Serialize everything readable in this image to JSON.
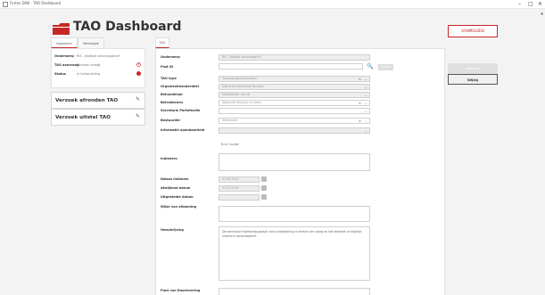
{
  "window": {
    "title": "Fortes DAB - TAO Dashboard",
    "minimize_glyph": "–",
    "maximize_glyph": "□",
    "close_glyph": "✕"
  },
  "header": {
    "page_title": "TAO Dashboard",
    "action_button_label": "AANMELDEN"
  },
  "left_panel": {
    "tabs": [
      {
        "label": "Algemeen"
      },
      {
        "label": "Werkwijze"
      }
    ],
    "info_rows": [
      {
        "key": "Onderwerp",
        "value": "RIS - digitale aanvraagbrief",
        "indicator": "none"
      },
      {
        "key": "TAO aanvraag",
        "value": "Thomas vraagt",
        "indicator": "alarm"
      },
      {
        "key": "Status",
        "value": "In behandeling",
        "indicator": "red"
      }
    ],
    "action_cards": [
      {
        "label": "Verzoek afronden TAO"
      },
      {
        "label": "Verzoek uitstel TAO"
      }
    ],
    "edit_glyph": "✎"
  },
  "form": {
    "tab_label": "TAO",
    "search_button_label": "Zoeken",
    "search_glyph": "🔍",
    "chevron_glyph": "⌄",
    "clear_glyph": "⊗",
    "fields": [
      {
        "label": "Onderwerp",
        "value": "RIS - digitale aanvraagbrief"
      },
      {
        "label": "Post ID",
        "value": ""
      },
      {
        "label": "TAO type",
        "value": "Toezeggingen/afspraken"
      },
      {
        "label": "Organisatieonderdeel",
        "value": "Dienst Infrastructuur Burgers"
      },
      {
        "label": "Behandelaar",
        "value": "Medewerker van de"
      },
      {
        "label": "Betrokkenen",
        "value": "Algemeen Bestuur en leden"
      },
      {
        "label": "Secretaris Portefeuille",
        "value": ""
      },
      {
        "label": "Bestuurder",
        "value": "Wethouder"
      },
      {
        "label": "Informatie openbaarheid",
        "value": ""
      },
      {
        "label": "",
        "value": "N.v.t. burger"
      },
      {
        "label": "Indieners",
        "value": ""
      },
      {
        "label": "Datum indienen",
        "value": "01-06-2020"
      },
      {
        "label": "Afwijkend datum",
        "value": "01-07-2020"
      },
      {
        "label": "Uitgestelde datum",
        "value": ""
      },
      {
        "label": "Wijze van afdoening",
        "value": ""
      },
      {
        "label": "Omschrijving",
        "value": "De werkwijze Hoofdonopgavaph rond ontwikkeling in termen die voorg en het afdoelen of digitale indieners aanvraagbrief."
      },
      {
        "label": "Punt van Doorlevering",
        "value": ""
      }
    ]
  },
  "side_buttons": [
    {
      "label": "Afronden"
    },
    {
      "label": "Wijzig"
    }
  ],
  "colors": {
    "accent": "#c62828",
    "panel": "#ffffff",
    "background": "#f3f3f3"
  }
}
